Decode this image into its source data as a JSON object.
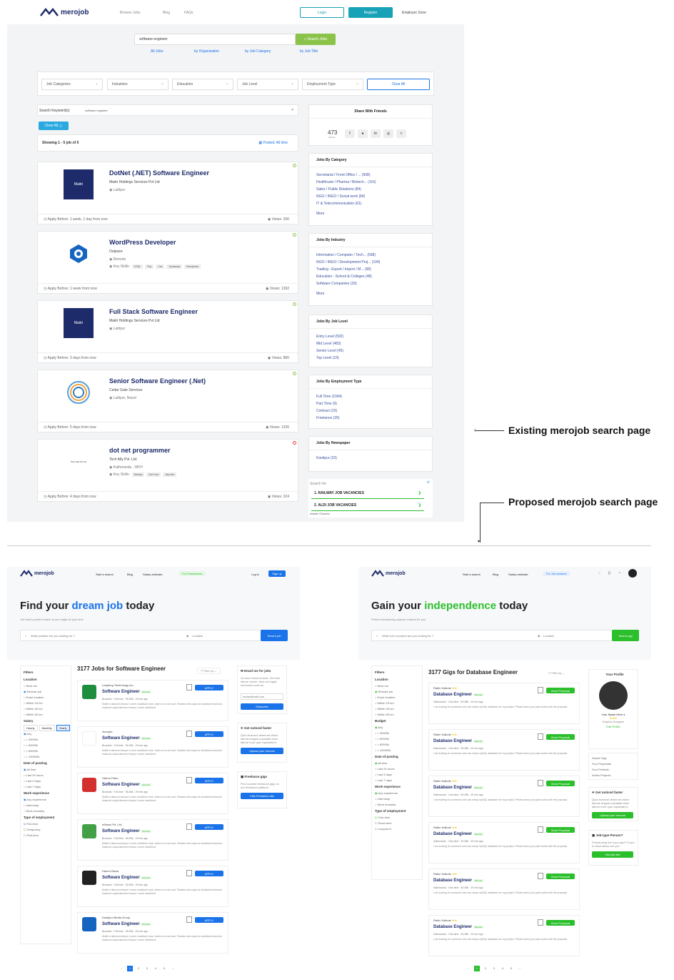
{
  "existing": {
    "brand": "merojob",
    "nav": [
      "Browse Jobs",
      "Blog",
      "FAQs"
    ],
    "login": "Login",
    "register": "Register",
    "employer_zone": "Employer Zone",
    "search_value": "software engineer",
    "search_button": "Search Jobs",
    "search_links": [
      "All Jobs",
      "by Organisation",
      "by Job Category",
      "by Job Title"
    ],
    "filters": [
      "Job Categories",
      "Industries",
      "Education",
      "Job Level",
      "Employment Type"
    ],
    "clear_all": "Clear All",
    "keyword_label": "Search Keyword(s)",
    "keyword_value": "software engineer",
    "clear_all_chip": "Clear All",
    "showing": "Showing 1 - 5 job of 5",
    "posted": "Posted: All time",
    "jobs": [
      {
        "title": "DotNet (.NET) Software Engineer",
        "company": "Maitri Holdings Services Pvt Ltd",
        "location": "Lalitpur",
        "skills_label": "",
        "skills": [],
        "apply": "Apply Before: 1 week, 1 day from now",
        "views": "Views: 290",
        "logo": "Maitri"
      },
      {
        "title": "WordPress Developer",
        "company": "Outpace",
        "location": "Remote",
        "skills_label": "Key Skills:",
        "skills": [
          "HTML",
          "Php",
          "Css",
          "Javascript",
          "Wordpress"
        ],
        "apply": "Apply Before: 1 week from now",
        "views": "Views: 1392",
        "logo": ""
      },
      {
        "title": "Full Stack Software Engineer",
        "company": "Maitri Holdings Services Pvt Ltd",
        "location": "Lalitpur",
        "skills_label": "",
        "skills": [],
        "apply": "Apply Before: 3 days from now",
        "views": "Views: 880",
        "logo": "Maitri"
      },
      {
        "title": "Senior Software Engineer (.Net)",
        "company": "Cedar Gate Services",
        "location": "Lalitpur, Nepal",
        "skills_label": "",
        "skills": [],
        "apply": "Apply Before: 5 days from now",
        "views": "Views: 1335",
        "logo": ""
      },
      {
        "title": "dot net programmer",
        "company": "Tech Ally Pvt. Ltd.",
        "location": "Kathmandu , WFH",
        "skills_label": "Key Skills:",
        "skills": [
          "Webapi",
          "Net Core",
          "Asp.Net"
        ],
        "apply": "Apply Before: 4 days from now",
        "views": "Views: 224",
        "logo": "Tech Ally Pvt Ltd"
      }
    ],
    "share": {
      "title": "Share With Friends",
      "count": "473",
      "count_label": "Shares"
    },
    "by_category": {
      "title": "Jobs By Category",
      "items": [
        "Secretarial / Front Office / ... (508)",
        "Healthcare / Pharma / Biotech... (116)",
        "Sales / Public Relations (84)",
        "NGO / INGO / Social work (84)",
        "IT & Telecommunication (61)"
      ],
      "more": "More"
    },
    "by_industry": {
      "title": "Jobs By Industry",
      "items": [
        "Information / Computer / Tech... (598)",
        "NGO / INGO / Development Proj... (104)",
        "Trading - Export / Import / M... (98)",
        "Education - School & Colleges (48)",
        "Software Companies (33)"
      ],
      "more": "More"
    },
    "by_level": {
      "title": "Jobs By Job Level",
      "items": [
        "Entry Level (592)",
        "Mid Level (483)",
        "Senior Level (45)",
        "Top Level (19)"
      ]
    },
    "by_type": {
      "title": "Jobs By Employment Type",
      "items": [
        "Full Time (1044)",
        "Part Time (9)",
        "Contract (23)",
        "Freelance (35)"
      ]
    },
    "by_newspaper": {
      "title": "Jobs By Newspaper",
      "items": [
        "Kantipur (33)"
      ]
    },
    "ad": {
      "search_for": "Search for",
      "items": [
        "1.  RAILWAY JOB VACANCIES",
        "2.  ALDI JOB VACANCIES"
      ],
      "footer": "Insider Choices"
    }
  },
  "annotations": {
    "existing": "Existing merojob search page",
    "proposed": "Proposed merojob search page"
  },
  "proposed_jobs": {
    "brand": "merojob",
    "nav": [
      "Start a search",
      "Blog",
      "Salary estimate"
    ],
    "pill": "For Freelancers",
    "login": "Log in",
    "signup": "Sign up",
    "hero_pre": "Find your ",
    "hero_hl": "dream job",
    "hero_post": " today",
    "sub": "Job that is perfect match to you might be just here.",
    "search_placeholder": "What position are you looking for ?",
    "location_placeholder": "Location",
    "search_btn": "Search job",
    "result_title": "3177 Jobs for Software Engineer",
    "filter_by": "Filter by",
    "filters_title": "Filters",
    "location_title": "Location",
    "location_items": [
      "Near me",
      "Remote job",
      "Exact location",
      "Within 15 km",
      "Within 30 km",
      "Within 50 km"
    ],
    "salary_title": "Salary",
    "salary_tabs": [
      "Hourly",
      "Monthly",
      "Yearly"
    ],
    "salary_items": [
      "Any",
      "> 30000k",
      "> 50000k",
      "> 80000k",
      "> 100000k"
    ],
    "date_title": "Date of posting",
    "date_items": [
      "All time",
      "Last 24 hours",
      "Last 3 days",
      "Last 7 days"
    ],
    "exp_title": "Work experience",
    "exp_items": [
      "Any experience",
      "Internship",
      "Work remotely"
    ],
    "type_title": "Type of employment",
    "type_items": [
      "Full-time",
      "Temporary",
      "Part-time"
    ],
    "cards": [
      {
        "company": "Leapfrog Technology Inc.",
        "color": "#1e8e3e"
      },
      {
        "company": "merojob",
        "color": "#ffffff"
      },
      {
        "company": "Hamro Patro",
        "color": "#d32f2f"
      },
      {
        "company": "eSewa Pvt. Ltd.",
        "color": "#43a047"
      },
      {
        "company": "Hamro Bazar",
        "color": "#222222"
      },
      {
        "company": "Kantipur Media Group",
        "color": "#1565c0"
      }
    ],
    "card_title": "Software Engineer",
    "card_badge": "Remote",
    "card_meta": "Brussels  ·  Full time  ·  50-55k  ·  29 min ago",
    "card_desc": "Mollit in laborum tempor Lorem incididunt irure. Aute eu ex ad sunt. Pariatur sint culpa do incididunt eiusmod eiusmod culpa laborum tempor Lorem incididunt.",
    "apply": "APPLY",
    "email_title": "Email me for jobs",
    "email_desc": "Ut esse eiusmod aute. Sit enim labore dolore. Aute ea fugiat commodo sunt ea.",
    "email_placeholder": "name@mail.com",
    "subscribe": "Subscribe",
    "noticed_title": "Get noticed faster",
    "noticed_desc": "Quis eiusmod deserunt cillum laboris magna cupidatat esse labore irure quis cupidatat in.",
    "upload": "Upload your resume",
    "freelance_title": "Freelance gigs",
    "freelance_desc": "Find curated freelance gigs on our freelance platform.",
    "visit": "Visit Freelance site",
    "pages": [
      "1",
      "2",
      "3",
      "4",
      "5"
    ]
  },
  "proposed_gigs": {
    "brand": "merojob",
    "nav": [
      "Start a search",
      "Blog",
      "Salary estimate"
    ],
    "pill": "For Job seekers",
    "hero_pre": "Gain your ",
    "hero_hl": "independence",
    "hero_post": " today",
    "sub": "Perfect freelancing projects curated for you",
    "search_placeholder": "What sort of project are you looking for ?",
    "location_placeholder": "Location",
    "search_btn": "Search gig",
    "result_title": "3177 Gigs for Database Engineer",
    "filter_by": "Filter by",
    "filters_title": "Filters",
    "location_title": "Location",
    "location_items": [
      "Near me",
      "Remote job",
      "Exact location",
      "Within 15 km",
      "Within 30 km",
      "Within 50 km"
    ],
    "budget_title": "Budget",
    "budget_items": [
      "Any",
      "> 30000k",
      "> 50000k",
      "> 80000k",
      "> 100000k"
    ],
    "date_title": "Date of posting",
    "date_items": [
      "All time",
      "Last 24 hours",
      "Last 3 days",
      "Last 7 days"
    ],
    "exp_title": "Work experience",
    "exp_items": [
      "Any experience",
      "Internship",
      "Work remotely"
    ],
    "type_title": "Type of employment",
    "type_items": [
      "One-time",
      "Short-term",
      "Long-term"
    ],
    "card_poster": "Rabin Kalkote",
    "card_title": "Database Engineer",
    "card_badge": "Remote",
    "card_meta": "Kathmandu  ·  One-time  ·  50-55k  ·  29 min ago",
    "card_desc": "I am looking for someone who can setup mySQL database for my project. Please send your past works with the proposal.",
    "send": "Send Proposal",
    "profile_title": "Your Profile",
    "profile_name": "Your Name Here",
    "profile_role": "Graphic Designer",
    "edit": "Edit Profile",
    "profile_links": [
      "Saved Gigs",
      "Your Proposals",
      "Your Portfolio",
      "Active Projects"
    ],
    "noticed_title": "Get noticed faster",
    "noticed_desc": "Quis eiusmod deserunt cillum laboris magna cupidatat esse labore irure quis cupidatat in.",
    "upload": "Upload your resume",
    "jobtype_title": "Job-type Person?",
    "jobtype_desc": "Freelancing isn't your type? If yes in what sitons are you",
    "visit": "Visit job site",
    "pages": [
      "1",
      "2",
      "3",
      "4",
      "5"
    ]
  },
  "colors": {
    "primary": "#1a73e8",
    "green": "#2bbf2b",
    "teal": "#17a2b8",
    "navy": "#1e2b6b"
  }
}
